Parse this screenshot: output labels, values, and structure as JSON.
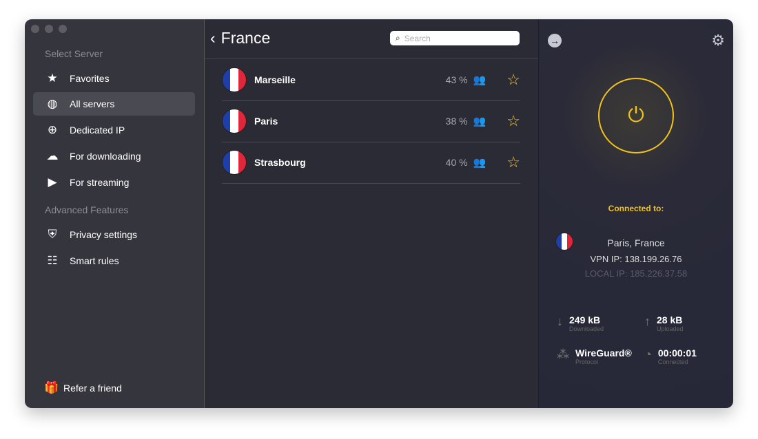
{
  "sidebar": {
    "section1": "Select Server",
    "items": [
      {
        "label": "Favorites",
        "icon": "star-icon"
      },
      {
        "label": "All servers",
        "icon": "globe-icon"
      },
      {
        "label": "Dedicated IP",
        "icon": "globe-pin-icon"
      },
      {
        "label": "For downloading",
        "icon": "cloud-download-icon"
      },
      {
        "label": "For streaming",
        "icon": "play-screen-icon"
      }
    ],
    "section2": "Advanced Features",
    "items2": [
      {
        "label": "Privacy settings",
        "icon": "shield-icon"
      },
      {
        "label": "Smart rules",
        "icon": "rules-icon"
      }
    ],
    "refer": "Refer a friend"
  },
  "main": {
    "title": "France",
    "search_placeholder": "Search",
    "servers": [
      {
        "city": "Marseille",
        "load": "43 %"
      },
      {
        "city": "Paris",
        "load": "38 %"
      },
      {
        "city": "Strasbourg",
        "load": "40 %"
      }
    ]
  },
  "status": {
    "connected_label": "Connected to:",
    "location": "Paris, France",
    "vpn_ip": "VPN IP: 138.199.26.76",
    "local_ip": "LOCAL IP: 185.226.37.58",
    "downloaded": "249 kB",
    "downloaded_label": "Downloaded",
    "uploaded": "28 kB",
    "uploaded_label": "Uploaded",
    "protocol": "WireGuard®",
    "protocol_label": "Protocol",
    "time": "00:00:01",
    "time_label": "Connected",
    "accent": "#f2c21b"
  }
}
